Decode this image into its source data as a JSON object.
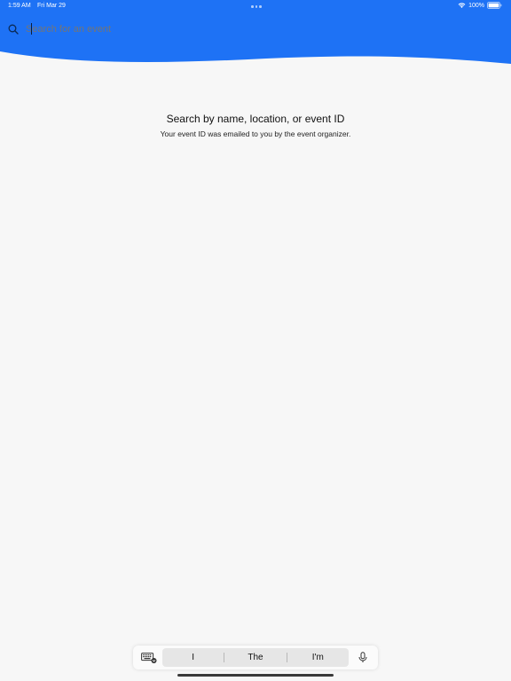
{
  "status_bar": {
    "time": "1:59 AM",
    "date": "Fri Mar 29",
    "battery": "100%"
  },
  "search": {
    "placeholder": "Search for an event",
    "value": ""
  },
  "empty_state": {
    "title": "Search by name, location, or event ID",
    "subtitle": "Your event ID was emailed to you by the event organizer."
  },
  "keyboard": {
    "suggestions": [
      "I",
      "The",
      "I'm"
    ],
    "icons": {
      "keyboard": "keyboard-icon",
      "mic": "microphone-icon"
    }
  },
  "colors": {
    "header": "#1e72f5",
    "background": "#f7f7f7"
  }
}
